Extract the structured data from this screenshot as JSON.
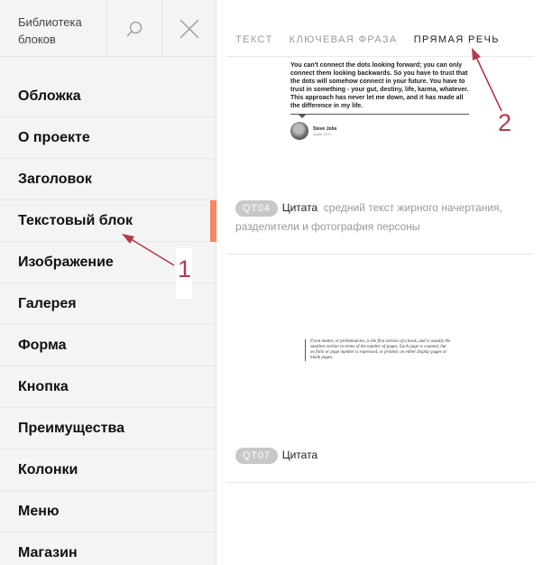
{
  "sidebar": {
    "title": "Библиотека блоков",
    "search_icon": "search-icon",
    "close_icon": "close-icon",
    "items": [
      {
        "label": "Обложка"
      },
      {
        "label": "О проекте"
      },
      {
        "label": "Заголовок"
      },
      {
        "label": "Текстовый блок",
        "active": true
      },
      {
        "label": "Изображение"
      },
      {
        "label": "Галерея"
      },
      {
        "label": "Форма"
      },
      {
        "label": "Кнопка"
      },
      {
        "label": "Преимущества"
      },
      {
        "label": "Колонки"
      },
      {
        "label": "Меню"
      },
      {
        "label": "Магазин"
      }
    ],
    "accent_color": "#f38a5f"
  },
  "tabs": [
    {
      "label": "ТЕКСТ"
    },
    {
      "label": "КЛЮЧЕВАЯ ФРАЗА"
    },
    {
      "label": "ПРЯМАЯ РЕЧЬ",
      "active": true
    }
  ],
  "blocks": [
    {
      "code": "QT04",
      "name": "Цитата",
      "description": "средний текст жирного начертания, разделители и фотография персоны",
      "preview": {
        "quote": "You can't connect the dots looking forward; you can only connect them looking backwards. So you have to trust that the dots will somehow connect in your future. You have to trust in something - your gut, destiny, life, karma, whatever. This approach has never let me down, and it has made all the difference in my life.",
        "person_name": "Steve Jobs",
        "person_role": "Apple CEO"
      }
    },
    {
      "code": "QT07",
      "name": "Цитата",
      "preview": {
        "quote": "Front matter, or preliminaries, is the first section of a book, and is usually the smallest section in terms of the number of pages. Each page is counted, but no folio or page number is expressed, or printed, on either display pages or blank pages."
      }
    }
  ],
  "annotations": [
    {
      "label": "1"
    },
    {
      "label": "2"
    }
  ],
  "annotation_color": "#b5384c"
}
